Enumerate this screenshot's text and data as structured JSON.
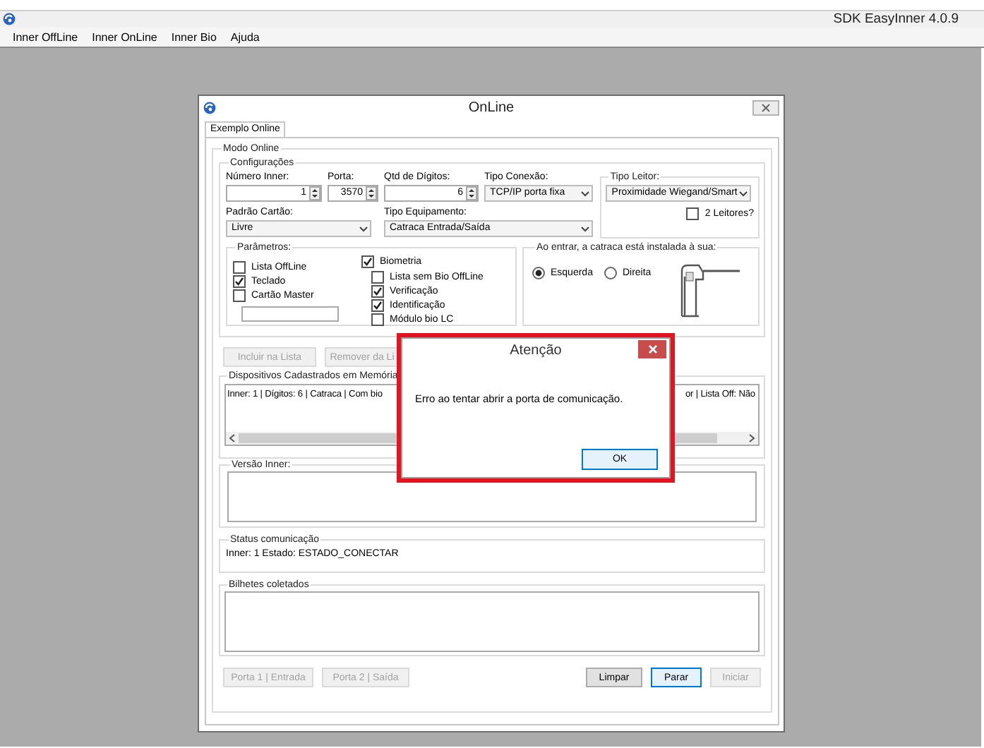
{
  "app": {
    "title": "SDK EasyInner 4.0.9"
  },
  "menu": [
    {
      "label": "Inner OffLine"
    },
    {
      "label": "Inner OnLine"
    },
    {
      "label": "Inner Bio"
    },
    {
      "label": "Ajuda"
    }
  ],
  "window": {
    "title": "OnLine"
  },
  "tabs": [
    {
      "label": "Exemplo Online",
      "selected": true
    }
  ],
  "modo_online": {
    "title": "Modo Online"
  },
  "configuracoes": {
    "title": "Configurações",
    "row_1": [
      {
        "label": "Número Inner:",
        "value": "1",
        "kind": "spinner"
      },
      {
        "label": "Porta:",
        "value": "3570",
        "kind": "spinner"
      },
      {
        "label": "Qtd de Dígitos:",
        "value": "6",
        "kind": "spinner"
      },
      {
        "label": "Tipo Conexão:",
        "value": "TCP/IP porta fixa",
        "kind": "dropdown"
      }
    ],
    "row_2": [
      {
        "label": "Padrão Cartão:",
        "value": "Livre",
        "kind": "dropdown"
      },
      {
        "label": "Tipo Equipamento:",
        "value": "Catraca Entrada/Saída",
        "kind": "dropdown"
      }
    ]
  },
  "tipo_leitor": {
    "title": "Tipo Leitor:",
    "value": "Proximidade Wiegand/Smart",
    "option": {
      "label": "2 Leitores?",
      "checked": false
    }
  },
  "parametros": {
    "title": "Parâmetros:",
    "options": [
      {
        "label": "Lista OffLine",
        "checked": false
      },
      {
        "label": "Teclado",
        "checked": true
      },
      {
        "label": "Cartão Master",
        "checked": false
      }
    ],
    "biometria": {
      "label": "Biometria",
      "checked": true,
      "children": [
        {
          "label": "Lista sem Bio OffLine",
          "checked": false
        },
        {
          "label": "Verificação",
          "checked": true
        },
        {
          "label": "Identificação",
          "checked": true
        },
        {
          "label": "Módulo bio LC",
          "checked": false
        }
      ]
    }
  },
  "catraca": {
    "title": "Ao entrar, a catraca está instalada à sua:",
    "options": [
      {
        "label": "Esquerda",
        "selected": true
      },
      {
        "label": "Direita",
        "selected": false
      }
    ]
  },
  "list_buttons": [
    {
      "label": "Incluir na Lista",
      "disabled": true
    },
    {
      "label": "Remover da Li",
      "disabled": true
    }
  ],
  "dispositivos": {
    "title": "Dispositivos Cadastrados em Memória",
    "rows": [
      {
        "visible_start": "Inner: 1 | Dígitos: 6 | Catraca | Com bio",
        "visible_end": "or | Lista Off: Não"
      }
    ]
  },
  "versao_inner": {
    "title": "Versão Inner:"
  },
  "status": {
    "title": "Status comunicação",
    "text": "Inner: 1 Estado: ESTADO_CONECTAR"
  },
  "bilhetes": {
    "title": "Bilhetes coletados"
  },
  "port_buttons": [
    {
      "label": "Porta 1 | Entrada",
      "disabled": true
    },
    {
      "label": "Porta 2 | Saída",
      "disabled": true
    }
  ],
  "action_buttons": [
    {
      "label": "Limpar",
      "disabled": false,
      "focused": false
    },
    {
      "label": "Parar",
      "disabled": false,
      "focused": true
    },
    {
      "label": "Iniciar",
      "disabled": true,
      "focused": false
    }
  ],
  "dialog": {
    "title": "Atenção",
    "message": "Erro ao tentar abrir a porta de comunicação.",
    "button": {
      "label": "OK",
      "focused": true
    }
  }
}
